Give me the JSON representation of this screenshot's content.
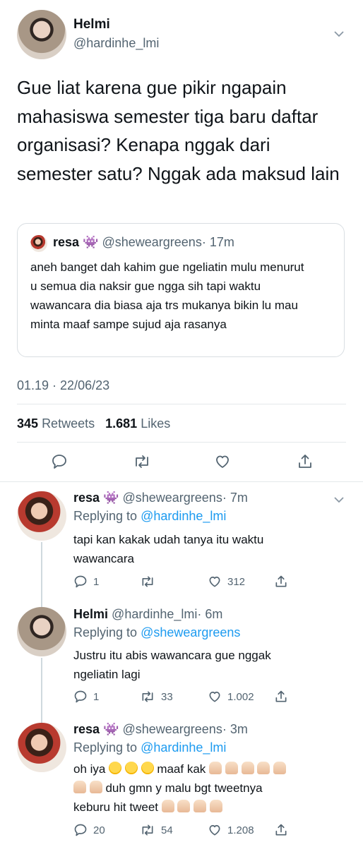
{
  "main_tweet": {
    "author_name": "Helmi",
    "author_handle": "@hardinhe_lmi",
    "text": "Gue liat karena gue pikir ngapain mahasiswa semester tiga baru daftar organisasi? Kenapa nggak dari semester satu? Nggak ada maksud lain",
    "quoted": {
      "author_name": "resa 👾",
      "author_handle": "@sheweargreens",
      "time": "· 17m",
      "text": "aneh banget dah kahim gue ngeliatin mulu menurut u semua dia naksir gue ngga sih tapi waktu wawancara dia biasa aja trs mukanya bikin lu mau minta maaf sampe sujud aja rasanya"
    },
    "timestamp": "01.19 · 22/06/23",
    "retweets_count": "345",
    "retweets_label": "Retweets",
    "likes_count": "1.681",
    "likes_label": "Likes"
  },
  "replies": [
    {
      "author_name": "resa 👾",
      "author_handle": "@sheweargreens",
      "time": "· 7m",
      "replying_prefix": "Replying to",
      "replying_to": "@hardinhe_lmi",
      "text": "tapi kan kakak udah tanya itu waktu wawancara",
      "reply_count": "1",
      "retweet_count": "",
      "like_count": "312"
    },
    {
      "author_name": "Helmi",
      "author_handle": "@hardinhe_lmi",
      "time": "· 6m",
      "replying_prefix": "Replying to",
      "replying_to": "@sheweargreens",
      "text": "Justru itu abis wawancara gue nggak ngeliatin lagi",
      "reply_count": "1",
      "retweet_count": "33",
      "like_count": "1.002"
    },
    {
      "author_name": "resa 👾",
      "author_handle": "@sheweargreens",
      "time": "· 3m",
      "replying_prefix": "Replying to",
      "replying_to": "@hardinhe_lmi",
      "text_line1": "oh iya",
      "text_mid": "maaf kak",
      "text_line2": "duh gmn y malu bgt tweetnya",
      "text_line3": "keburu hit tweet",
      "reply_count": "20",
      "retweet_count": "54",
      "like_count": "1.208"
    }
  ],
  "icons": {
    "chevron": "chevron-down-icon",
    "reply": "reply-icon",
    "retweet": "retweet-icon",
    "like": "heart-icon",
    "share": "share-icon"
  }
}
